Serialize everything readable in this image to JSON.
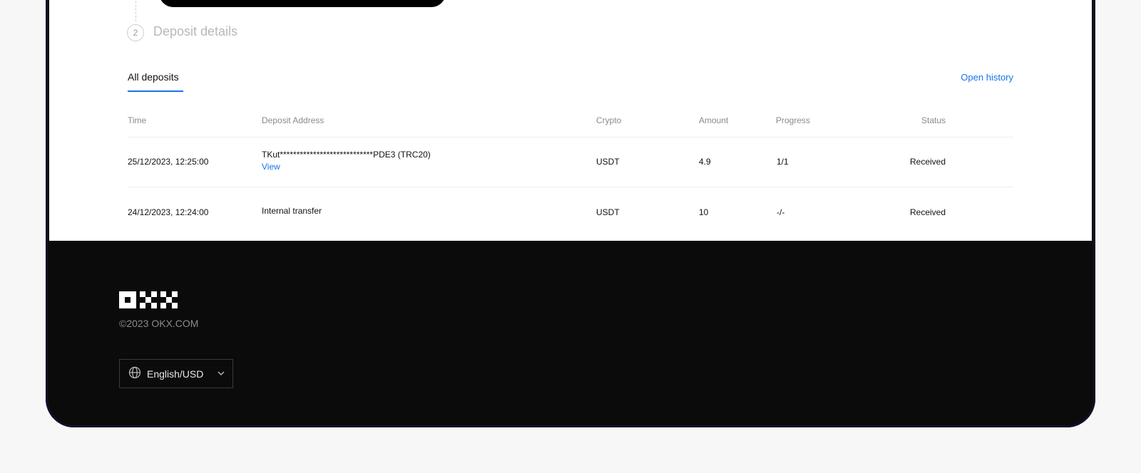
{
  "stepper": {
    "step2_number": "2",
    "step2_title": "Deposit details"
  },
  "tabs": {
    "all_deposits": "All deposits",
    "open_history": "Open history"
  },
  "table": {
    "columns": {
      "time": "Time",
      "address": "Deposit Address",
      "crypto": "Crypto",
      "amount": "Amount",
      "progress": "Progress",
      "status": "Status"
    },
    "rows": [
      {
        "time": "25/12/2023, 12:25:00",
        "address": "TKut****************************PDE3 (TRC20)",
        "address_link": "View",
        "crypto": "USDT",
        "amount": "4.9",
        "progress": "1/1",
        "status": "Received"
      },
      {
        "time": "24/12/2023, 12:24:00",
        "address": "Internal transfer",
        "crypto": "USDT",
        "amount": "10",
        "progress": "-/-",
        "status": "Received"
      }
    ]
  },
  "footer": {
    "copyright": "©2023 OKX.COM",
    "language": "English/USD"
  },
  "colors": {
    "accent": "#1a73e8",
    "footer_bg": "#0b0b0b"
  }
}
